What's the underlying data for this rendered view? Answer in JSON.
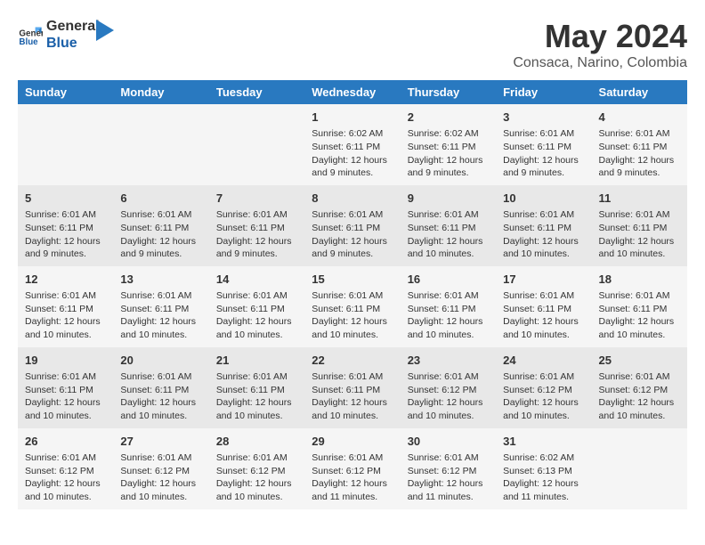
{
  "header": {
    "logo_line1": "General",
    "logo_line2": "Blue",
    "title": "May 2024",
    "subtitle": "Consaca, Narino, Colombia"
  },
  "weekdays": [
    "Sunday",
    "Monday",
    "Tuesday",
    "Wednesday",
    "Thursday",
    "Friday",
    "Saturday"
  ],
  "weeks": [
    [
      {
        "day": "",
        "info": ""
      },
      {
        "day": "",
        "info": ""
      },
      {
        "day": "",
        "info": ""
      },
      {
        "day": "1",
        "info": "Sunrise: 6:02 AM\nSunset: 6:11 PM\nDaylight: 12 hours\nand 9 minutes."
      },
      {
        "day": "2",
        "info": "Sunrise: 6:02 AM\nSunset: 6:11 PM\nDaylight: 12 hours\nand 9 minutes."
      },
      {
        "day": "3",
        "info": "Sunrise: 6:01 AM\nSunset: 6:11 PM\nDaylight: 12 hours\nand 9 minutes."
      },
      {
        "day": "4",
        "info": "Sunrise: 6:01 AM\nSunset: 6:11 PM\nDaylight: 12 hours\nand 9 minutes."
      }
    ],
    [
      {
        "day": "5",
        "info": "Sunrise: 6:01 AM\nSunset: 6:11 PM\nDaylight: 12 hours\nand 9 minutes."
      },
      {
        "day": "6",
        "info": "Sunrise: 6:01 AM\nSunset: 6:11 PM\nDaylight: 12 hours\nand 9 minutes."
      },
      {
        "day": "7",
        "info": "Sunrise: 6:01 AM\nSunset: 6:11 PM\nDaylight: 12 hours\nand 9 minutes."
      },
      {
        "day": "8",
        "info": "Sunrise: 6:01 AM\nSunset: 6:11 PM\nDaylight: 12 hours\nand 9 minutes."
      },
      {
        "day": "9",
        "info": "Sunrise: 6:01 AM\nSunset: 6:11 PM\nDaylight: 12 hours\nand 10 minutes."
      },
      {
        "day": "10",
        "info": "Sunrise: 6:01 AM\nSunset: 6:11 PM\nDaylight: 12 hours\nand 10 minutes."
      },
      {
        "day": "11",
        "info": "Sunrise: 6:01 AM\nSunset: 6:11 PM\nDaylight: 12 hours\nand 10 minutes."
      }
    ],
    [
      {
        "day": "12",
        "info": "Sunrise: 6:01 AM\nSunset: 6:11 PM\nDaylight: 12 hours\nand 10 minutes."
      },
      {
        "day": "13",
        "info": "Sunrise: 6:01 AM\nSunset: 6:11 PM\nDaylight: 12 hours\nand 10 minutes."
      },
      {
        "day": "14",
        "info": "Sunrise: 6:01 AM\nSunset: 6:11 PM\nDaylight: 12 hours\nand 10 minutes."
      },
      {
        "day": "15",
        "info": "Sunrise: 6:01 AM\nSunset: 6:11 PM\nDaylight: 12 hours\nand 10 minutes."
      },
      {
        "day": "16",
        "info": "Sunrise: 6:01 AM\nSunset: 6:11 PM\nDaylight: 12 hours\nand 10 minutes."
      },
      {
        "day": "17",
        "info": "Sunrise: 6:01 AM\nSunset: 6:11 PM\nDaylight: 12 hours\nand 10 minutes."
      },
      {
        "day": "18",
        "info": "Sunrise: 6:01 AM\nSunset: 6:11 PM\nDaylight: 12 hours\nand 10 minutes."
      }
    ],
    [
      {
        "day": "19",
        "info": "Sunrise: 6:01 AM\nSunset: 6:11 PM\nDaylight: 12 hours\nand 10 minutes."
      },
      {
        "day": "20",
        "info": "Sunrise: 6:01 AM\nSunset: 6:11 PM\nDaylight: 12 hours\nand 10 minutes."
      },
      {
        "day": "21",
        "info": "Sunrise: 6:01 AM\nSunset: 6:11 PM\nDaylight: 12 hours\nand 10 minutes."
      },
      {
        "day": "22",
        "info": "Sunrise: 6:01 AM\nSunset: 6:11 PM\nDaylight: 12 hours\nand 10 minutes."
      },
      {
        "day": "23",
        "info": "Sunrise: 6:01 AM\nSunset: 6:12 PM\nDaylight: 12 hours\nand 10 minutes."
      },
      {
        "day": "24",
        "info": "Sunrise: 6:01 AM\nSunset: 6:12 PM\nDaylight: 12 hours\nand 10 minutes."
      },
      {
        "day": "25",
        "info": "Sunrise: 6:01 AM\nSunset: 6:12 PM\nDaylight: 12 hours\nand 10 minutes."
      }
    ],
    [
      {
        "day": "26",
        "info": "Sunrise: 6:01 AM\nSunset: 6:12 PM\nDaylight: 12 hours\nand 10 minutes."
      },
      {
        "day": "27",
        "info": "Sunrise: 6:01 AM\nSunset: 6:12 PM\nDaylight: 12 hours\nand 10 minutes."
      },
      {
        "day": "28",
        "info": "Sunrise: 6:01 AM\nSunset: 6:12 PM\nDaylight: 12 hours\nand 10 minutes."
      },
      {
        "day": "29",
        "info": "Sunrise: 6:01 AM\nSunset: 6:12 PM\nDaylight: 12 hours\nand 11 minutes."
      },
      {
        "day": "30",
        "info": "Sunrise: 6:01 AM\nSunset: 6:12 PM\nDaylight: 12 hours\nand 11 minutes."
      },
      {
        "day": "31",
        "info": "Sunrise: 6:02 AM\nSunset: 6:13 PM\nDaylight: 12 hours\nand 11 minutes."
      },
      {
        "day": "",
        "info": ""
      }
    ]
  ]
}
